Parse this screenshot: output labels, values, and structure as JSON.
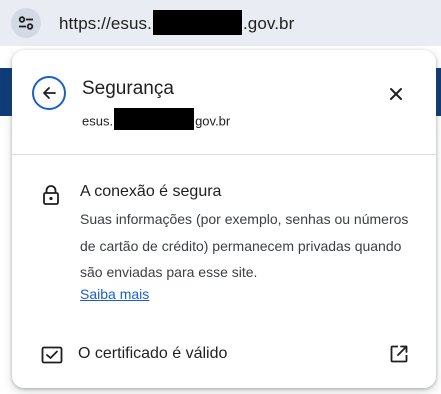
{
  "omnibox": {
    "url_prefix": "https://esus.",
    "url_suffix": ".gov.br",
    "chip_icon": "tune-icon"
  },
  "popup": {
    "title": "Segurança",
    "subtitle_prefix": "esus.",
    "subtitle_suffix": "gov.br",
    "back_icon": "arrow-back-icon",
    "close_icon": "close-icon"
  },
  "connection": {
    "icon": "lock-icon",
    "title": "A conexão é segura",
    "description": "Suas informações (por exemplo, senhas ou números de cartão de crédito) permanecem privadas quando são enviadas para esse site.",
    "learn_more": "Saiba mais"
  },
  "certificate": {
    "icon": "certificate-icon",
    "label": "O certificado é válido",
    "external_icon": "open-in-new-icon"
  },
  "colors": {
    "accent": "#1a5fd0",
    "page_band": "#0f3d79",
    "omnibox_bg": "#e9ecf3"
  }
}
